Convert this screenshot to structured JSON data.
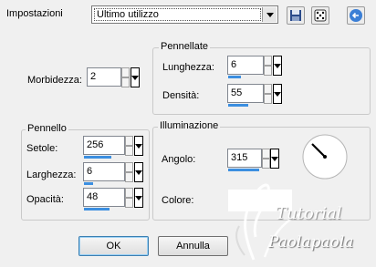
{
  "preset": {
    "label": "Impostazioni",
    "selected": "Ultimo utilizzo",
    "buttons": [
      "save-icon",
      "randomize-dice-icon",
      "reset-icon"
    ]
  },
  "morbidezza": {
    "label": "Morbidezza:",
    "value": "2"
  },
  "pennellate": {
    "title": "Pennellate",
    "lunghezza": {
      "label": "Lunghezza:",
      "value": "6"
    },
    "densita": {
      "label": "Densità:",
      "value": "55"
    }
  },
  "pennello": {
    "title": "Pennello",
    "setole": {
      "label": "Setole:",
      "value": "256"
    },
    "larghezza": {
      "label": "Larghezza:",
      "value": "6"
    },
    "opacita": {
      "label": "Opacità:",
      "value": "48"
    }
  },
  "illuminazione": {
    "title": "Illuminazione",
    "angolo": {
      "label": "Angolo:",
      "value": "315"
    },
    "colore": {
      "label": "Colore:",
      "swatch": "#ffffff"
    }
  },
  "buttons": {
    "ok": "OK",
    "annulla": "Annulla"
  },
  "watermark": {
    "line1": "Tutorial",
    "line2": "Paolapaola"
  },
  "colors": {
    "accent": "#3c8fe0",
    "background": "#f0f0f0"
  }
}
